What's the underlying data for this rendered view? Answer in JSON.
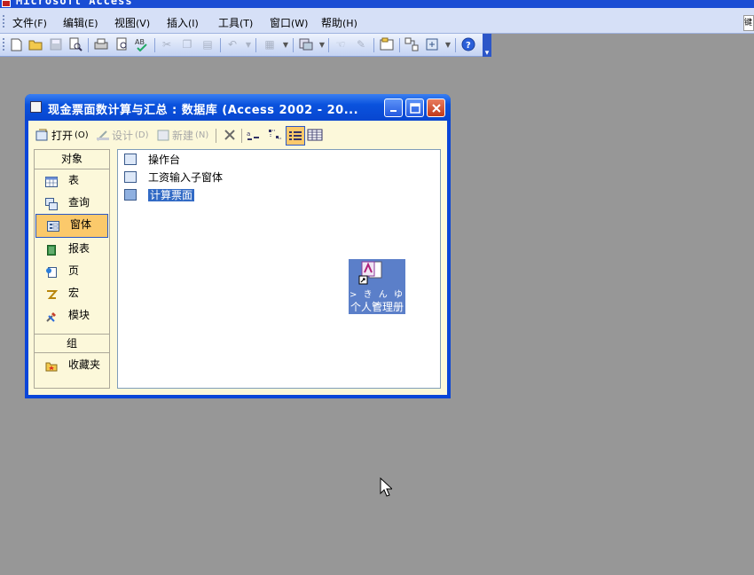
{
  "app": {
    "title": "Microsoft Access"
  },
  "menu": [
    {
      "label": "文件",
      "key": "(F)"
    },
    {
      "label": "编辑",
      "key": "(E)"
    },
    {
      "label": "视图",
      "key": "(V)"
    },
    {
      "label": "插入",
      "key": "(I)"
    },
    {
      "label": "工具",
      "key": "(T)"
    },
    {
      "label": "窗口",
      "key": "(W)"
    },
    {
      "label": "帮助",
      "key": "(H)"
    }
  ],
  "menu_right_fragment": "键",
  "db_window": {
    "title": "现金票面数计算与汇总 : 数据库 (Access 2002 - 20...",
    "toolbar": {
      "open": {
        "label": "打开",
        "key": "(O)"
      },
      "design": {
        "label": "设计",
        "key": "(D)"
      },
      "new": {
        "label": "新建",
        "key": "(N)"
      }
    },
    "objects_header": "对象",
    "objects": [
      "表",
      "查询",
      "窗体",
      "报表",
      "页",
      "宏",
      "模块"
    ],
    "selected_object": "窗体",
    "groups_header": "组",
    "groups": [
      "收藏夹"
    ],
    "list_items": [
      "操作台",
      "工资输入子窗体",
      "计算票面"
    ],
    "selected_item": "计算票面"
  },
  "desktop_icon": {
    "line1": "> き ん ゆ >",
    "line2": "个人管理册"
  }
}
